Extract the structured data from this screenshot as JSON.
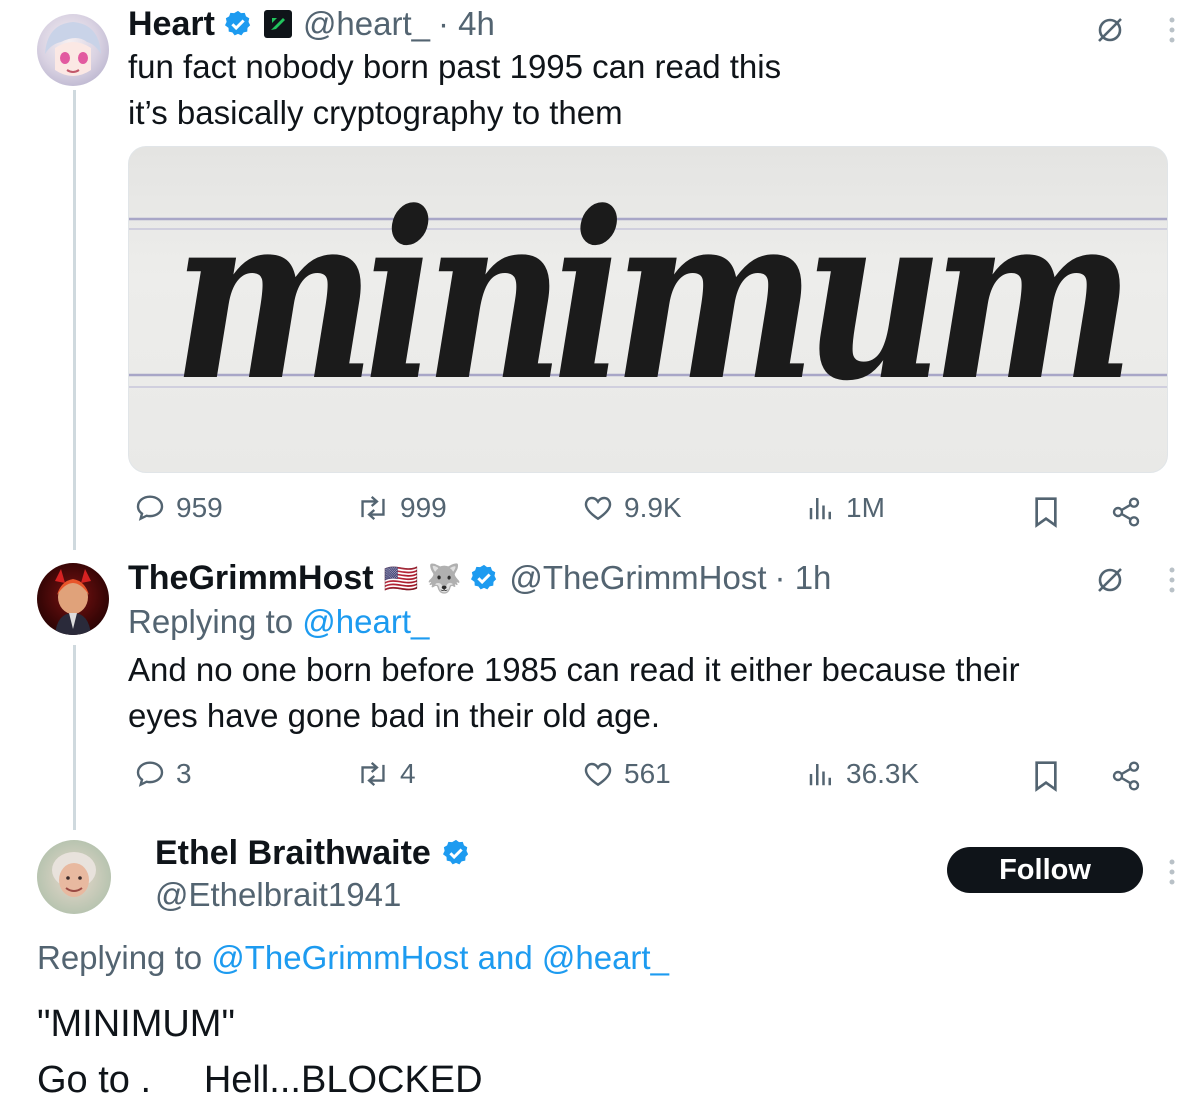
{
  "tweet1": {
    "name": "Heart",
    "handle": "@heart_",
    "time": "· 4h",
    "text_line1": "fun fact nobody born past 1995 can read this",
    "text_line2": "it’s basically cryptography to them",
    "media_word": "minimum",
    "metrics": {
      "replies": "959",
      "retweets": "999",
      "likes": "9.9K",
      "views": "1M"
    }
  },
  "tweet2": {
    "name": "TheGrimmHost",
    "flag_emoji": "🇺🇸",
    "wolf_emoji": "🐺",
    "handle": "@TheGrimmHost",
    "time": "· 1h",
    "replying_prefix": "Replying to ",
    "replying_to": "@heart_",
    "text_line1": "And no one born before 1985 can read it either because their",
    "text_line2": "eyes have gone bad in their old age.",
    "metrics": {
      "replies": "3",
      "retweets": "4",
      "likes": "561",
      "views": "36.3K"
    }
  },
  "tweet3": {
    "name": "Ethel Braithwaite",
    "handle": "@Ethelbrait1941",
    "follow_label": "Follow",
    "replying_prefix": "Replying to ",
    "replying_to_1": "@TheGrimmHost",
    "replying_and": " and ",
    "replying_to_2": "@heart_",
    "text_line1": "\"MINIMUM\"",
    "text_line2": "Go to .     Hell...BLOCKED"
  },
  "colors": {
    "accent": "#1d9bf0",
    "text": "#0f1419",
    "muted": "#536471",
    "verified": "#1d9bf0",
    "affiliate_badge": "#16a34a"
  }
}
